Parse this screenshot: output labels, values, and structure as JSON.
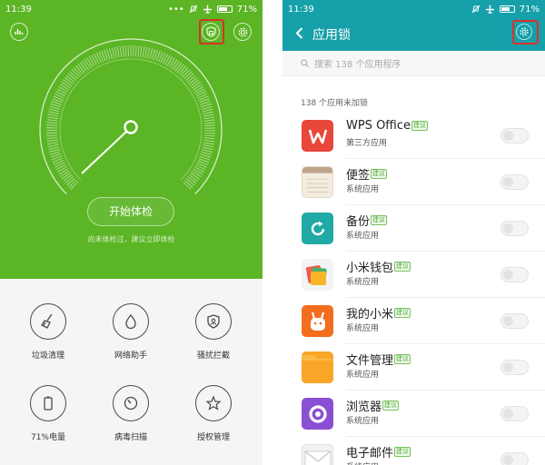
{
  "colors": {
    "security_green": "#5bb524",
    "header_teal": "#16a0a9",
    "highlight_red": "#d9322b",
    "badge_green": "#4ca832"
  },
  "left_screen": {
    "status": {
      "time": "11:39",
      "battery": "71%",
      "icons": [
        "more-dots-icon",
        "silent-icon",
        "airplane-icon",
        "battery-icon"
      ]
    },
    "top_icons": [
      "stats-icon",
      "shield-lock-icon",
      "settings-icon"
    ],
    "start_button": "开始体检",
    "hint": "尚未体检过，建议立即体检",
    "tiles": [
      {
        "label": "垃圾清理",
        "icon": "broom-icon"
      },
      {
        "label": "网络助手",
        "icon": "drop-icon"
      },
      {
        "label": "骚扰拦截",
        "icon": "shield-user-icon"
      },
      {
        "label": "71%电量",
        "icon": "battery-icon"
      },
      {
        "label": "病毒扫描",
        "icon": "gauge-icon"
      },
      {
        "label": "授权管理",
        "icon": "star-icon"
      }
    ]
  },
  "right_screen": {
    "status": {
      "time": "11:39",
      "battery": "71%"
    },
    "title": "应用锁",
    "search_placeholder": "搜索 138 个应用程序",
    "section_title": "138 个应用未加锁",
    "badge": "建议",
    "apps": [
      {
        "name": "WPS Office",
        "type": "第三方应用",
        "recommended": true,
        "icon": "wps-icon",
        "color": "#e8473b"
      },
      {
        "name": "便签",
        "type": "系统应用",
        "recommended": true,
        "icon": "notes-icon",
        "color": "#f3ecdf"
      },
      {
        "name": "备份",
        "type": "系统应用",
        "recommended": true,
        "icon": "backup-icon",
        "color": "#21a9a6"
      },
      {
        "name": "小米钱包",
        "type": "系统应用",
        "recommended": true,
        "icon": "wallet-icon",
        "color": "#f4f4f4"
      },
      {
        "name": "我的小米",
        "type": "系统应用",
        "recommended": true,
        "icon": "mi-bunny-icon",
        "color": "#f26d1d"
      },
      {
        "name": "文件管理",
        "type": "系统应用",
        "recommended": true,
        "icon": "folder-icon",
        "color": "#f9a628"
      },
      {
        "name": "浏览器",
        "type": "系统应用",
        "recommended": true,
        "icon": "browser-icon",
        "color": "#8b4fd3"
      },
      {
        "name": "电子邮件",
        "type": "系统应用",
        "recommended": true,
        "icon": "mail-icon",
        "color": "#f2f2f2"
      }
    ]
  }
}
